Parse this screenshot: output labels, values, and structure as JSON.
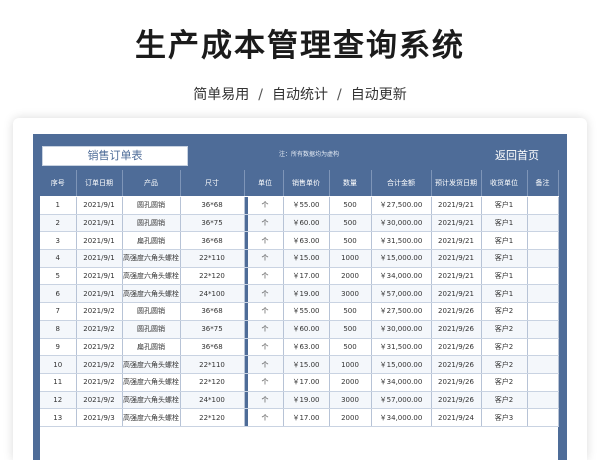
{
  "header": {
    "title": "生产成本管理查询系统",
    "breadcrumbs": [
      "简单易用",
      "自动统计",
      "自动更新"
    ],
    "separator": "/"
  },
  "sheet": {
    "name": "销售订单表",
    "note": "注：所有数据均为虚构",
    "back_label": "返回首页"
  },
  "columns": [
    "序号",
    "订单日期",
    "产品",
    "尺寸",
    "单位",
    "销售单价",
    "数量",
    "合计金额",
    "预计发货日期",
    "收货单位",
    "备注"
  ],
  "rows": [
    [
      "1",
      "2021/9/1",
      "圆孔圆销",
      "36*68",
      "个",
      "￥55.00",
      "500",
      "￥27,500.00",
      "2021/9/21",
      "客户1",
      ""
    ],
    [
      "2",
      "2021/9/1",
      "圆孔圆销",
      "36*75",
      "个",
      "￥60.00",
      "500",
      "￥30,000.00",
      "2021/9/21",
      "客户1",
      ""
    ],
    [
      "3",
      "2021/9/1",
      "扁孔圆销",
      "36*68",
      "个",
      "￥63.00",
      "500",
      "￥31,500.00",
      "2021/9/21",
      "客户1",
      ""
    ],
    [
      "4",
      "2021/9/1",
      "高强度六角头螺栓",
      "22*110",
      "个",
      "￥15.00",
      "1000",
      "￥15,000.00",
      "2021/9/21",
      "客户1",
      ""
    ],
    [
      "5",
      "2021/9/1",
      "高强度六角头螺栓",
      "22*120",
      "个",
      "￥17.00",
      "2000",
      "￥34,000.00",
      "2021/9/21",
      "客户1",
      ""
    ],
    [
      "6",
      "2021/9/1",
      "高强度六角头螺栓",
      "24*100",
      "个",
      "￥19.00",
      "3000",
      "￥57,000.00",
      "2021/9/21",
      "客户1",
      ""
    ],
    [
      "7",
      "2021/9/2",
      "圆孔圆销",
      "36*68",
      "个",
      "￥55.00",
      "500",
      "￥27,500.00",
      "2021/9/26",
      "客户2",
      ""
    ],
    [
      "8",
      "2021/9/2",
      "圆孔圆销",
      "36*75",
      "个",
      "￥60.00",
      "500",
      "￥30,000.00",
      "2021/9/26",
      "客户2",
      ""
    ],
    [
      "9",
      "2021/9/2",
      "扁孔圆销",
      "36*68",
      "个",
      "￥63.00",
      "500",
      "￥31,500.00",
      "2021/9/26",
      "客户2",
      ""
    ],
    [
      "10",
      "2021/9/2",
      "高强度六角头螺栓",
      "22*110",
      "个",
      "￥15.00",
      "1000",
      "￥15,000.00",
      "2021/9/26",
      "客户2",
      ""
    ],
    [
      "11",
      "2021/9/2",
      "高强度六角头螺栓",
      "22*120",
      "个",
      "￥17.00",
      "2000",
      "￥34,000.00",
      "2021/9/26",
      "客户2",
      ""
    ],
    [
      "12",
      "2021/9/2",
      "高强度六角头螺栓",
      "24*100",
      "个",
      "￥19.00",
      "3000",
      "￥57,000.00",
      "2021/9/26",
      "客户2",
      ""
    ],
    [
      "13",
      "2021/9/3",
      "高强度六角头螺栓",
      "22*120",
      "个",
      "￥17.00",
      "2000",
      "￥34,000.00",
      "2021/9/24",
      "客户3",
      ""
    ]
  ]
}
